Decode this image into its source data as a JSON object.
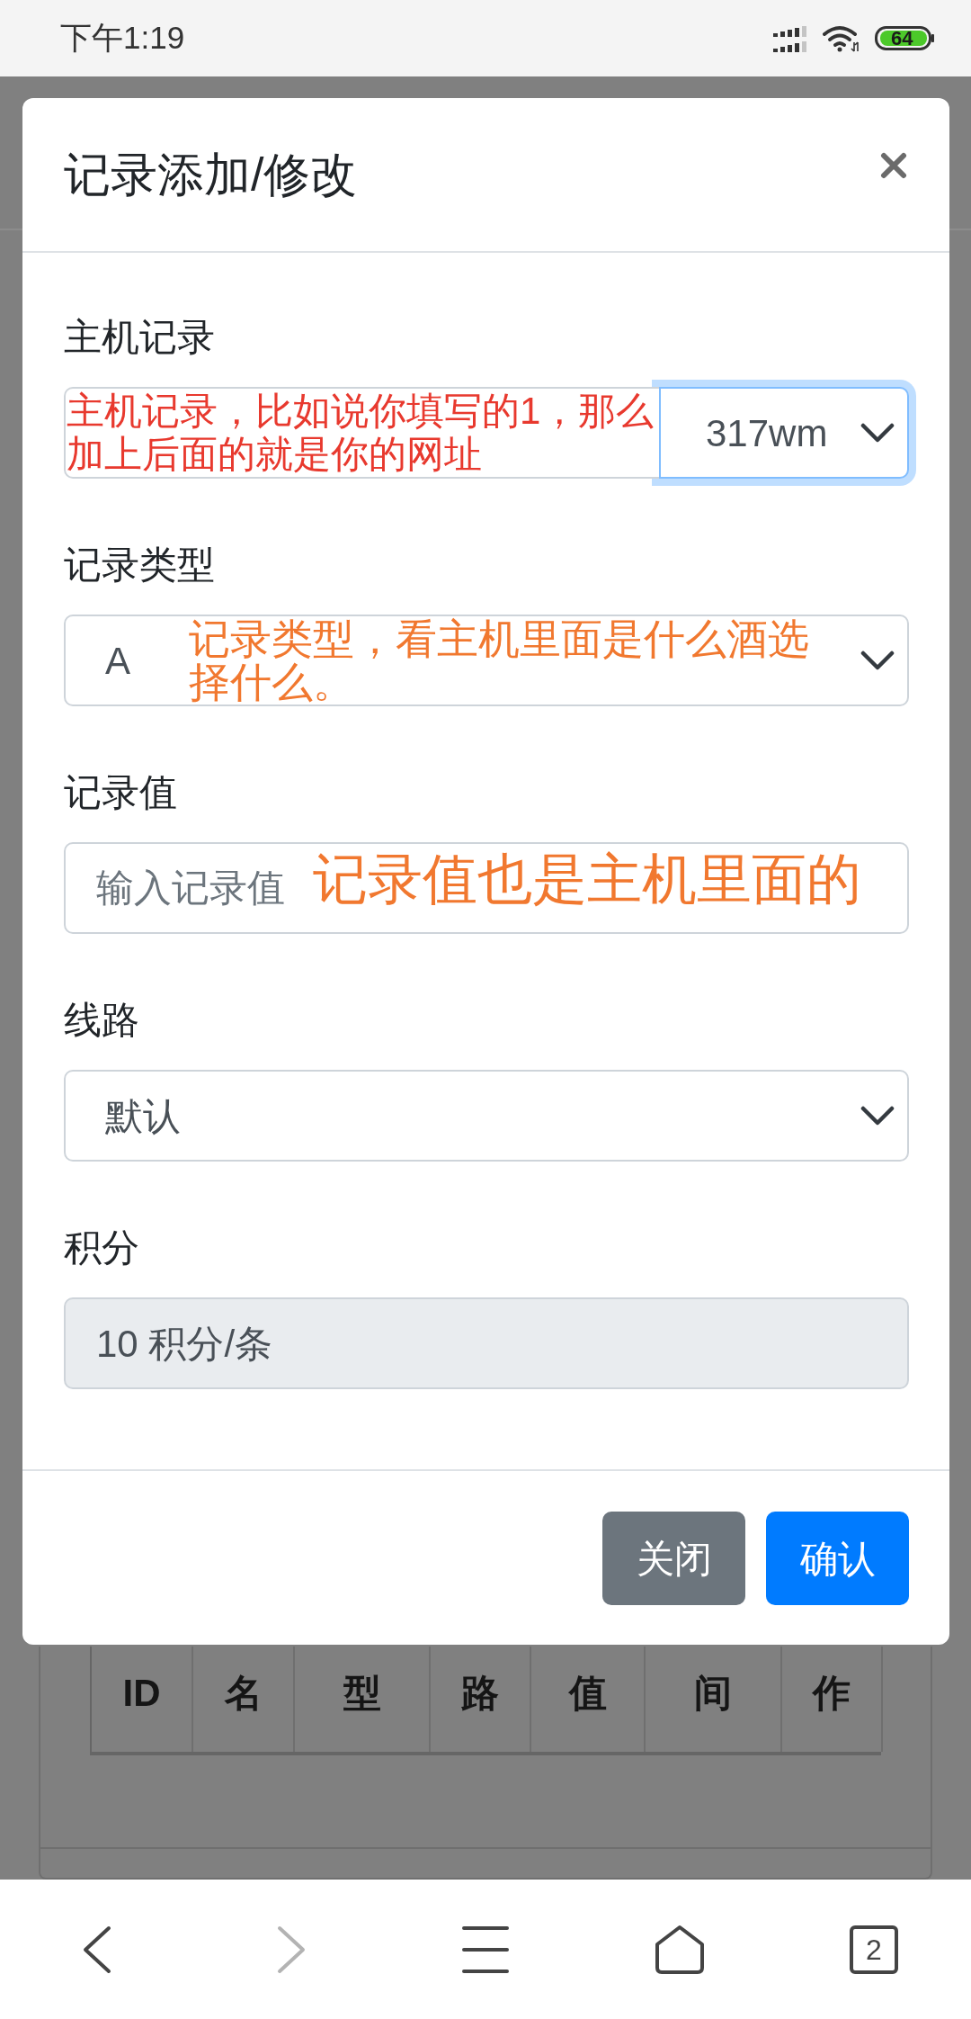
{
  "status_bar": {
    "time": "下午1:19",
    "battery": "64"
  },
  "modal": {
    "title": "记录添加/修改",
    "fields": [
      {
        "kind": "input_group",
        "label": "主机记录",
        "value": "317wm",
        "focused": true,
        "annotation": {
          "text": "主机记录，比如说你填写的1，那么加上后面的就是你的网址",
          "color": "#e8392e"
        }
      },
      {
        "kind": "select",
        "label": "记录类型",
        "value": "A",
        "focused": false,
        "annotation": {
          "text": "记录类型，看主机里面是什么酒选择什么。",
          "color": "#f1782f"
        }
      },
      {
        "kind": "input",
        "label": "记录值",
        "placeholder": "输入记录值",
        "focused": false,
        "annotation": {
          "text": "记录值也是主机里面的",
          "color": "#f1782f"
        }
      },
      {
        "kind": "select",
        "label": "线路",
        "value": "默认",
        "focused": false
      },
      {
        "kind": "readonly",
        "label": "积分",
        "value": "10 积分/条",
        "focused": false
      }
    ],
    "buttons": [
      {
        "kind": "secondary",
        "label": "关闭"
      },
      {
        "kind": "primary",
        "label": "确认"
      }
    ]
  },
  "background_table": {
    "columns": [
      "ID",
      "名",
      "型",
      "路",
      "值",
      "间",
      "作"
    ]
  },
  "bottom_nav": [
    {
      "kind": "back",
      "disabled": false
    },
    {
      "kind": "forward",
      "disabled": true
    },
    {
      "kind": "menu",
      "disabled": false
    },
    {
      "kind": "home",
      "disabled": false
    },
    {
      "kind": "tabs",
      "disabled": false,
      "count": "2"
    }
  ]
}
